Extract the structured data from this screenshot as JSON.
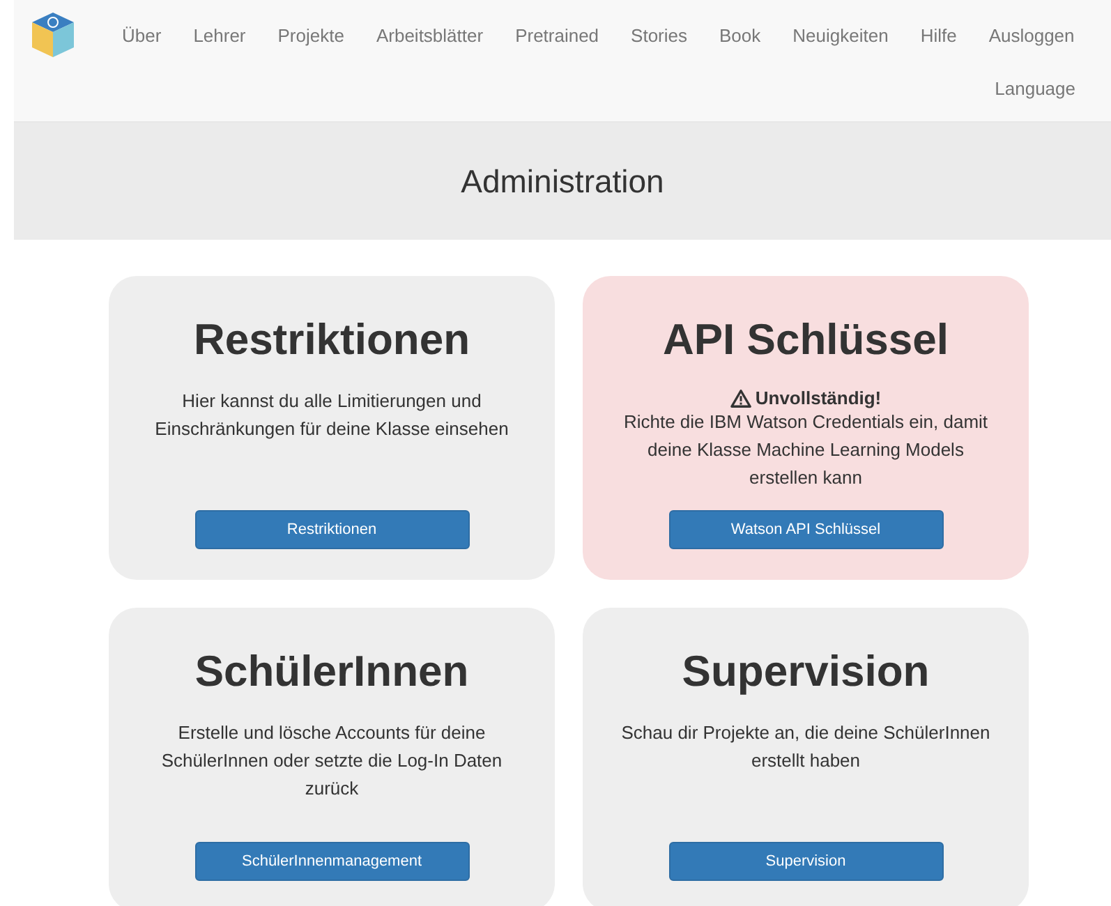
{
  "nav": {
    "items": [
      "Über",
      "Lehrer",
      "Projekte",
      "Arbeitsblätter",
      "Pretrained",
      "Stories",
      "Book",
      "Neuigkeiten",
      "Hilfe",
      "Ausloggen"
    ],
    "language": "Language"
  },
  "page_title": "Administration",
  "cards": [
    {
      "kind": "normal",
      "title": "Restriktionen",
      "description": "Hier kannst du alle Limitierungen und Einschränkungen für deine Klasse einsehen",
      "button": "Restriktionen"
    },
    {
      "kind": "alert",
      "title": "API Schlüssel",
      "warning": "Unvollständig!",
      "description": "Richte die IBM Watson Credentials ein, damit deine Klasse Machine Learning Models erstellen kann",
      "button": "Watson API Schlüssel"
    },
    {
      "kind": "normal",
      "title": "SchülerInnen",
      "description": "Erstelle und lösche Accounts für deine SchülerInnen oder setzte die Log-In Daten zurück",
      "button": "SchülerInnenmanagement"
    },
    {
      "kind": "normal",
      "title": "Supervision",
      "description": "Schau dir Projekte an, die deine SchülerInnen erstellt haben",
      "button": "Supervision"
    }
  ]
}
